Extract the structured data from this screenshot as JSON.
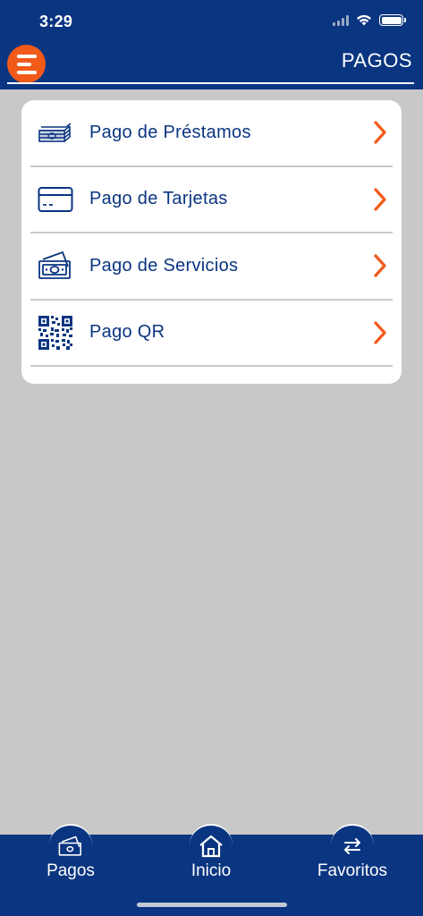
{
  "status": {
    "time": "3:29"
  },
  "header": {
    "title": "PAGOS",
    "menu_icon": "hamburger-menu-icon"
  },
  "payments": {
    "items": [
      {
        "label": "Pago de Préstamos",
        "icon": "money-stack-icon"
      },
      {
        "label": "Pago de Tarjetas",
        "icon": "credit-card-icon"
      },
      {
        "label": "Pago de Servicios",
        "icon": "banknotes-icon"
      },
      {
        "label": "Pago QR",
        "icon": "qr-code-icon"
      }
    ]
  },
  "bottom_nav": {
    "tabs": [
      {
        "label": "Pagos",
        "icon": "banknotes-icon"
      },
      {
        "label": "Inicio",
        "icon": "home-icon"
      },
      {
        "label": "Favoritos",
        "icon": "transfer-arrows-icon"
      }
    ]
  },
  "colors": {
    "primary": "#0a3580",
    "accent": "#f25a1a",
    "background": "#c8c8c8"
  }
}
